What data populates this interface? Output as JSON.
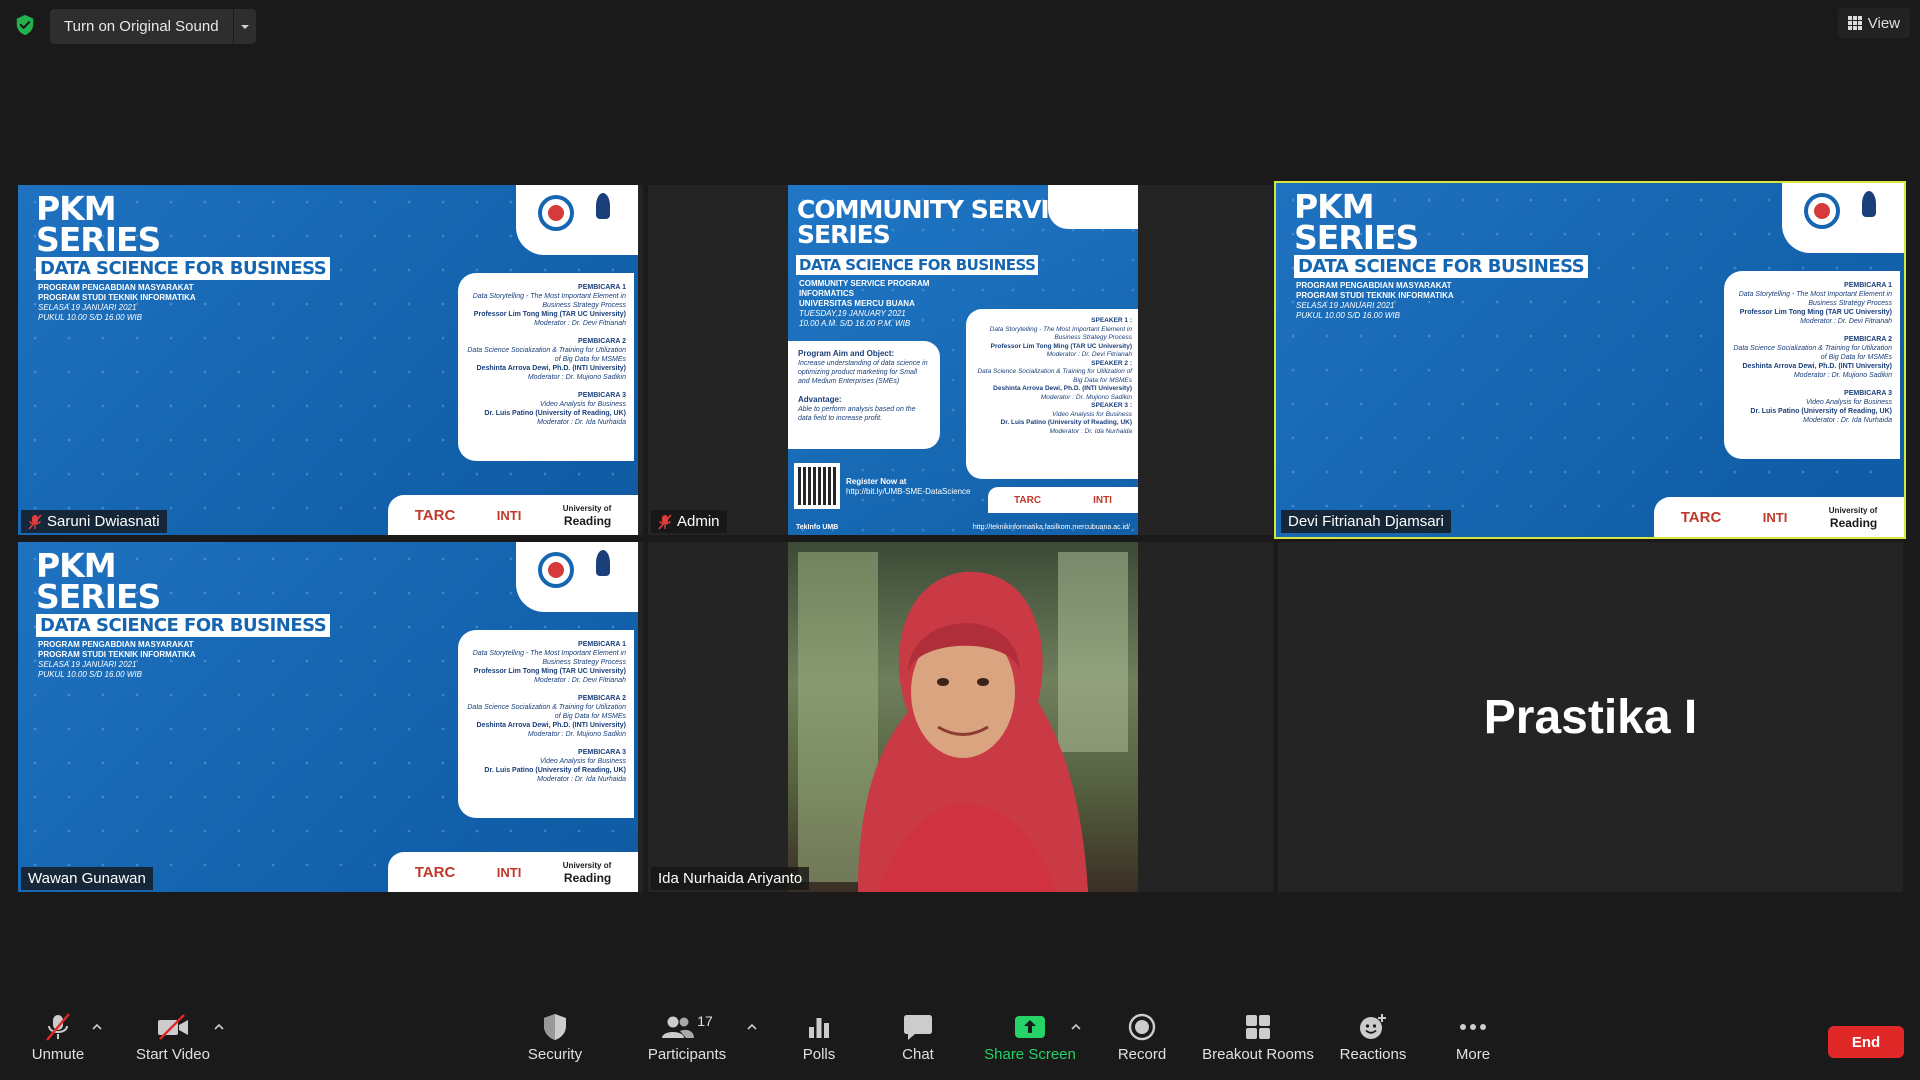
{
  "top_bar": {
    "original_sound_label": "Turn on Original Sound",
    "view_label": "View"
  },
  "poster_wide": {
    "title_line1": "PKM",
    "title_line2": "SERIES",
    "subtitle": "DATA SCIENCE FOR BUSINESS",
    "program_line1": "PROGRAM PENGABDIAN MASYARAKAT",
    "program_line2": "PROGRAM STUDI TEKNIK INFORMATIKA",
    "date_line": "SELASA 19 JANUARI 2021",
    "time_line": "PUKUL 10.00 S/D 16.00 WIB",
    "speakers": [
      {
        "head": "PEMBICARA 1",
        "topic": "Data Storytelling - The Most Important Element in Business Strategy Process",
        "name": "Professor Lim Tong Ming (TAR UC University)",
        "mod": "Moderator : Dr. Devi Fitrianah"
      },
      {
        "head": "PEMBICARA 2",
        "topic": "Data Science Socialization & Training for Utilization of Big Data for MSMEs",
        "name": "Deshinta Arrova Dewi, Ph.D. (INTI University)",
        "mod": "Moderator : Dr. Mujiono Sadikin"
      },
      {
        "head": "PEMBICARA 3",
        "topic": "Video Analysis for Business",
        "name": "Dr. Luis Patino (University of Reading, UK)",
        "mod": "Moderator : Dr. Ida Nurhaida"
      }
    ],
    "logo_tarc": "TARC",
    "logo_inti": "INTI",
    "logo_reading_line1": "University of",
    "logo_reading_line2": "Reading"
  },
  "poster_portrait": {
    "title_line1": "COMMUNITY SERVICE",
    "title_line2": "SERIES",
    "subtitle": "DATA SCIENCE FOR BUSINESS",
    "info_line1": "COMMUNITY SERVICE PROGRAM",
    "info_line2": "INFORMATICS",
    "info_line3": "UNIVERSITAS MERCU BUANA",
    "info_line4": "TUESDAY,19 JANUARY 2021",
    "info_line5": "10.00 A.M. S/D 16.00 P.M. WIB",
    "aim_head": "Program Aim and Object:",
    "aim_text": "Increase understanding of data science in optimizing product marketing for Small and Medium Enterprises (SMEs)",
    "adv_head": "Advantage:",
    "adv_text": "Able to perform analysis based on the data field to increase profit.",
    "speakers": [
      {
        "head": "SPEAKER 1 :",
        "topic": "Data Storytelling - The Most Important Element in Business Strategy Process",
        "name": "Professor Lim Tong Ming (TAR UC University)",
        "mod": "Moderator : Dr. Devi Fitrianah"
      },
      {
        "head": "SPEAKER 2 :",
        "topic": "Data Science Socialization & Training for Utilization of Big Data for MSMEs",
        "name": "Deshinta Arrova Dewi, Ph.D. (INTI University)",
        "mod": "Moderator : Dr. Mujiono Sadikin"
      },
      {
        "head": "SPEAKER 3 :",
        "topic": "Video Analysis for Business",
        "name": "Dr. Luis Patino (University of Reading, UK)",
        "mod": "Moderator : Dr. Ida Nurhaida"
      }
    ],
    "register_line1": "Register Now at",
    "register_line2": "http://bit.ly/UMB-SME-DataScience",
    "footer_left": "TekInfo UMB",
    "footer_right": "http://teknikinformatika.fasilkom.mercubuana.ac.id/",
    "logo_tarc": "TARC",
    "logo_inti": "INTI"
  },
  "participants": [
    {
      "name": "Saruni Dwiasnati",
      "muted": true
    },
    {
      "name": "Admin",
      "muted": true
    },
    {
      "name": "Devi Fitrianah Djamsari",
      "muted": false,
      "active_speaker": true
    },
    {
      "name": "Wawan Gunawan",
      "muted": false
    },
    {
      "name": "Ida Nurhaida Ariyanto",
      "muted": false
    },
    {
      "name": "Prastika I",
      "muted": false
    }
  ],
  "toolbar": {
    "unmute": "Unmute",
    "start_video": "Start Video",
    "security": "Security",
    "participants": "Participants",
    "participants_count": "17",
    "polls": "Polls",
    "chat": "Chat",
    "share_screen": "Share Screen",
    "record": "Record",
    "breakout_rooms": "Breakout Rooms",
    "reactions": "Reactions",
    "more": "More",
    "end": "End"
  },
  "colors": {
    "background": "#1a1a1a",
    "active_speaker_border": "#d6e63c",
    "share_green": "#25d366",
    "end_red": "#e02828",
    "security_shield": "#23b14d"
  }
}
